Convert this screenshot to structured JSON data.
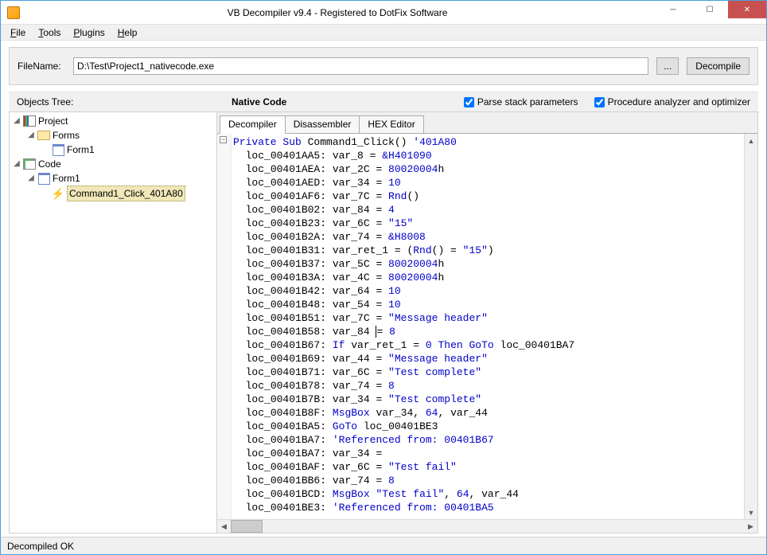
{
  "window": {
    "title": "VB Decompiler v9.4 - Registered to DotFix Software"
  },
  "menu": {
    "file": "File",
    "tools": "Tools",
    "plugins": "Plugins",
    "help": "Help"
  },
  "filename": {
    "label": "FileName:",
    "value": "D:\\Test\\Project1_nativecode.exe",
    "browse": "...",
    "decompile": "Decompile"
  },
  "options": {
    "objects_tree": "Objects Tree:",
    "native_code": "Native Code",
    "parse_stack": "Parse stack parameters",
    "proc_analyzer": "Procedure analyzer and optimizer"
  },
  "tree": {
    "project": "Project",
    "forms": "Forms",
    "form1_a": "Form1",
    "code": "Code",
    "form1_b": "Form1",
    "command1": "Command1_Click_401A80"
  },
  "tabs": {
    "decompiler": "Decompiler",
    "disassembler": "Disassembler",
    "hexeditor": "HEX Editor"
  },
  "code": {
    "sig_kw1": "Private Sub",
    "sig_name": " Command1_Click() ",
    "sig_cm": "'401A80",
    "lines": [
      {
        "loc": "loc_00401AA5:",
        "var": "var_8",
        "op": "=",
        "val": "&H401090",
        "t": "hx"
      },
      {
        "loc": "loc_00401AEA:",
        "var": "var_2C",
        "op": "=",
        "val": "80020004",
        "suf": "h",
        "t": "hx"
      },
      {
        "loc": "loc_00401AED:",
        "var": "var_34",
        "op": "=",
        "val": "10",
        "t": "num"
      },
      {
        "loc": "loc_00401AF6:",
        "var": "var_7C",
        "op": "=",
        "val": "Rnd",
        "paren": "()",
        "t": "kw"
      },
      {
        "loc": "loc_00401B02:",
        "var": "var_84",
        "op": "=",
        "val": "4",
        "t": "num"
      },
      {
        "loc": "loc_00401B23:",
        "var": "var_6C",
        "op": "=",
        "val": "\"15\"",
        "t": "str"
      },
      {
        "loc": "loc_00401B2A:",
        "var": "var_74",
        "op": "=",
        "val": "&H8008",
        "t": "hx"
      },
      {
        "loc": "loc_00401B31:",
        "raw": true,
        "html": "var_ret_1 = (<span class='kw'>Rnd</span>() = <span class='str'>\"15\"</span>)"
      },
      {
        "loc": "loc_00401B37:",
        "var": "var_5C",
        "op": "=",
        "val": "80020004",
        "suf": "h",
        "t": "hx"
      },
      {
        "loc": "loc_00401B3A:",
        "var": "var_4C",
        "op": "=",
        "val": "80020004",
        "suf": "h",
        "t": "hx"
      },
      {
        "loc": "loc_00401B42:",
        "var": "var_64",
        "op": "=",
        "val": "10",
        "t": "num"
      },
      {
        "loc": "loc_00401B48:",
        "var": "var_54",
        "op": "=",
        "val": "10",
        "t": "num"
      },
      {
        "loc": "loc_00401B51:",
        "var": "var_7C",
        "op": "=",
        "val": "\"Message header\"",
        "t": "str"
      },
      {
        "loc": "loc_00401B58:",
        "raw": true,
        "html": "var_84 <span style='border-left:1px solid #000'>=</span> <span class='num'>8</span>"
      },
      {
        "loc": "loc_00401B67:",
        "raw": true,
        "html": "<span class='kw'>If</span> var_ret_1 = <span class='num'>0</span> <span class='kw'>Then GoTo</span> loc_00401BA7"
      },
      {
        "loc": "loc_00401B69:",
        "var": "var_44",
        "op": "=",
        "val": "\"Message header\"",
        "t": "str"
      },
      {
        "loc": "loc_00401B71:",
        "var": "var_6C",
        "op": "=",
        "val": "\"Test complete\"",
        "t": "str"
      },
      {
        "loc": "loc_00401B78:",
        "var": "var_74",
        "op": "=",
        "val": "8",
        "t": "num"
      },
      {
        "loc": "loc_00401B7B:",
        "var": "var_34",
        "op": "=",
        "val": "\"Test complete\"",
        "t": "str"
      },
      {
        "loc": "loc_00401B8F:",
        "raw": true,
        "html": "<span class='kw'>MsgBox</span> var_34, <span class='num'>64</span>, var_44"
      },
      {
        "loc": "loc_00401BA5:",
        "raw": true,
        "html": "<span class='kw'>GoTo</span> loc_00401BE3"
      },
      {
        "loc": "loc_00401BA7:",
        "raw": true,
        "html": "<span class='cm'>'Referenced from: 00401B67</span>"
      },
      {
        "loc": "loc_00401BA7:",
        "var": "var_34",
        "op": "=",
        "val": "",
        "t": "plain"
      },
      {
        "loc": "loc_00401BAF:",
        "var": "var_6C",
        "op": "=",
        "val": "\"Test fail\"",
        "t": "str"
      },
      {
        "loc": "loc_00401BB6:",
        "var": "var_74",
        "op": "=",
        "val": "8",
        "t": "num"
      },
      {
        "loc": "loc_00401BCD:",
        "raw": true,
        "html": "<span class='kw'>MsgBox</span> <span class='str'>\"Test fail\"</span>, <span class='num'>64</span>, var_44"
      },
      {
        "loc": "loc_00401BE3:",
        "raw": true,
        "html": "<span class='cm'>'Referenced from: 00401BA5</span>"
      }
    ]
  },
  "status": {
    "text": "Decompiled OK"
  }
}
